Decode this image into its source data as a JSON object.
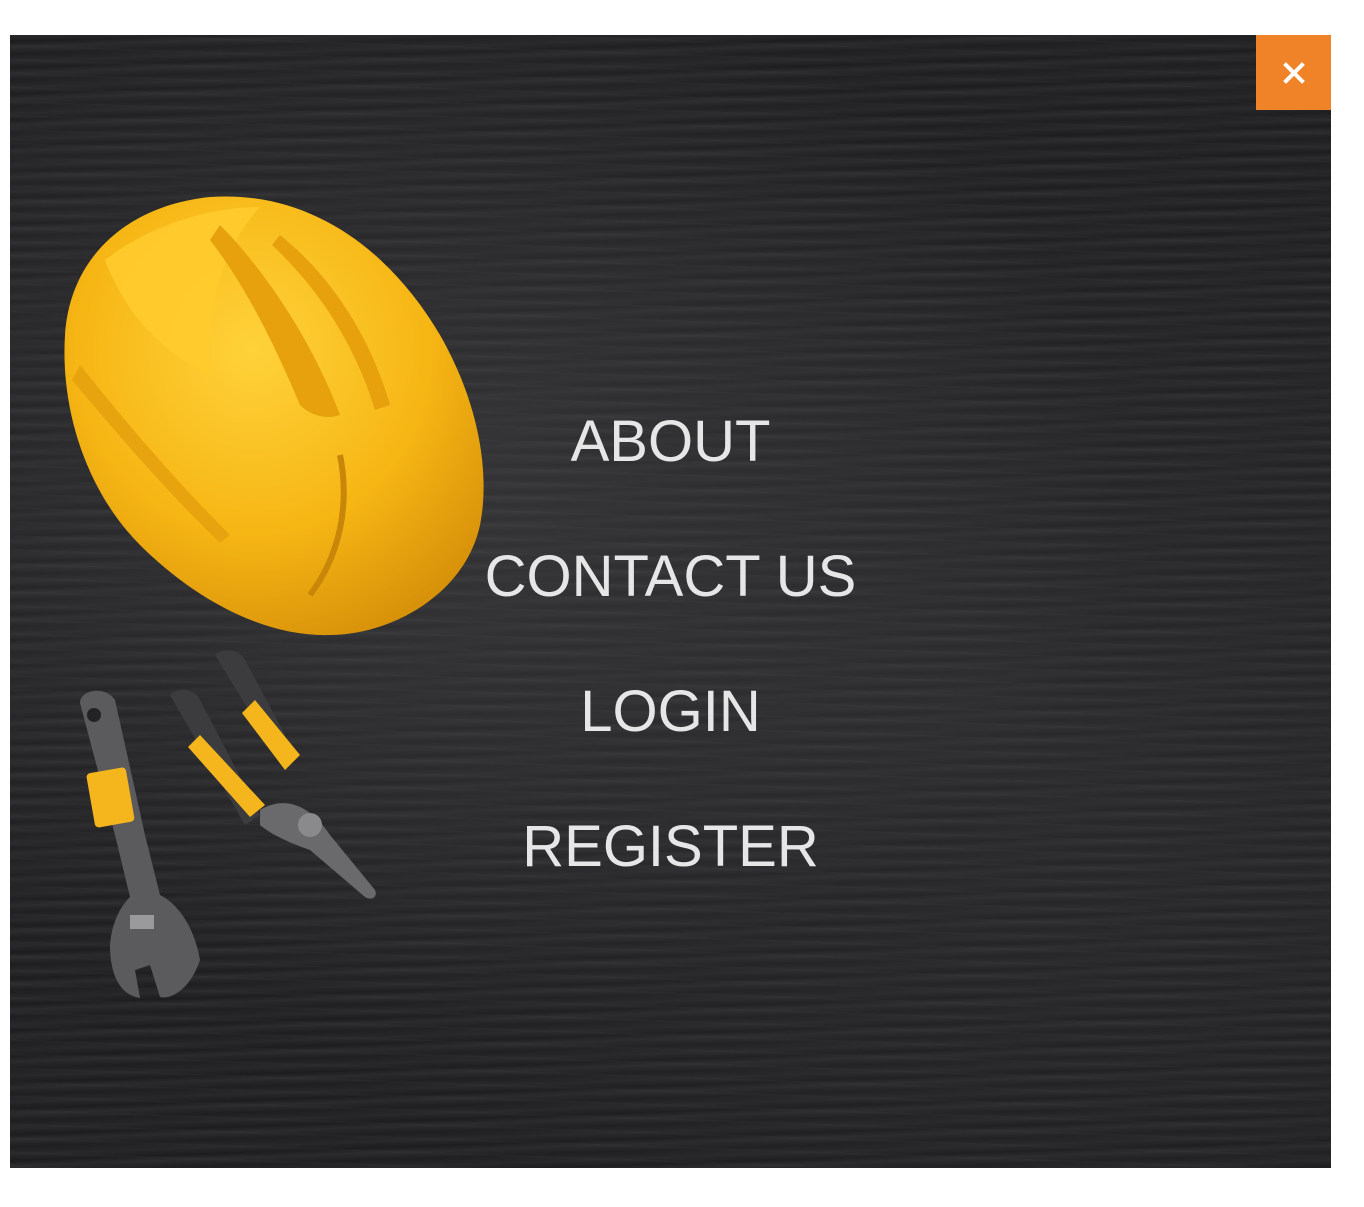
{
  "menu": {
    "items": [
      {
        "label": "ABOUT"
      },
      {
        "label": "CONTACT US"
      },
      {
        "label": "LOGIN"
      },
      {
        "label": "REGISTER"
      }
    ]
  },
  "close": {
    "icon": "close-icon"
  },
  "background": {
    "image": "hard-hat-and-tools-on-dark-wood"
  },
  "colors": {
    "accent": "#f08328",
    "menu_text": "#e6e6e6",
    "background": "#232325",
    "helmet": "#f5b51c"
  }
}
